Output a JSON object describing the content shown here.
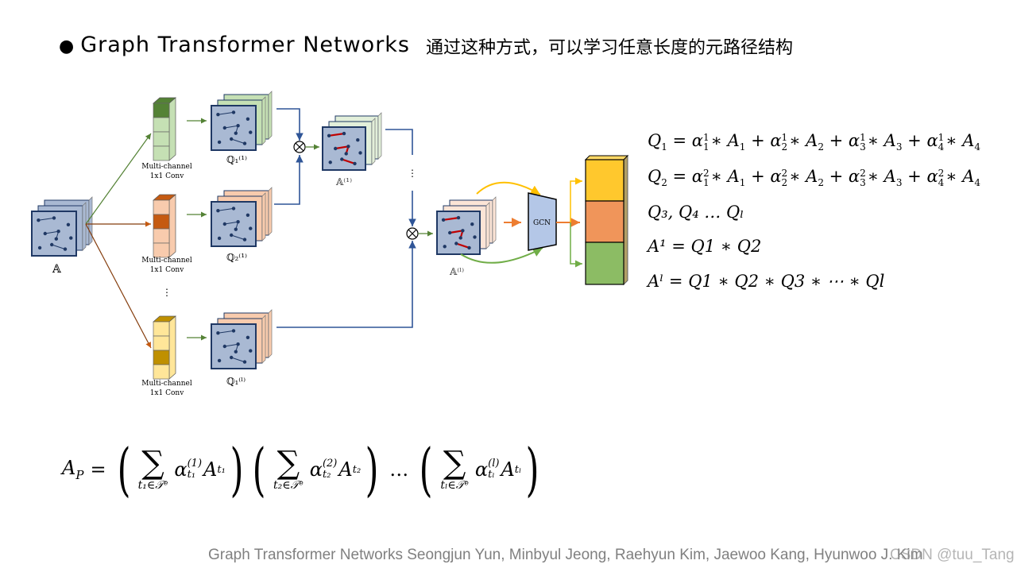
{
  "slide": {
    "bullet": "●",
    "title": "Graph Transformer Networks",
    "subtitle": "通过这种方式，可以学习任意长度的元路径结构"
  },
  "diagram": {
    "input_label": "𝔸",
    "conv_label_line1": "Multi-channel",
    "conv_label_line2": "1x1 Conv",
    "q_labels": [
      "ℚ₁⁽¹⁾",
      "ℚ₂⁽¹⁾",
      "ℚ₁⁽ˡ⁾"
    ],
    "a1_label": "𝔸⁽¹⁾",
    "al_label": "𝔸⁽ˡ⁾",
    "gcn_label": "GCN",
    "vdots": "⋮",
    "multiply_symbol": "⊗",
    "colors": {
      "graph_face": "#a9b9d3",
      "graph_border": "#1f3864",
      "edge_red": "#c00000",
      "green_dark": "#548235",
      "green_light": "#c5e0b4",
      "orange_dark": "#c55a11",
      "orange_light": "#f8cbad",
      "yellow_dark": "#bf9000",
      "yellow_light": "#ffe699",
      "output_yellow": "#ffc82d",
      "output_orange": "#f0955a",
      "output_green": "#8cbc64",
      "gcn_fill": "#b4c7e7",
      "line_blue": "#2f5597"
    }
  },
  "equations": {
    "q1": {
      "lhs": "Q",
      "lhs_sub": "1",
      "terms": [
        {
          "sup": "1",
          "sub": "1",
          "a_sub": "1"
        },
        {
          "sup": "1",
          "sub": "2",
          "a_sub": "2"
        },
        {
          "sup": "1",
          "sub": "3",
          "a_sub": "3"
        },
        {
          "sup": "1",
          "sub": "4",
          "a_sub": "4"
        }
      ]
    },
    "q2": {
      "lhs": "Q",
      "lhs_sub": "2",
      "terms": [
        {
          "sup": "2",
          "sub": "1",
          "a_sub": "1"
        },
        {
          "sup": "2",
          "sub": "2",
          "a_sub": "2"
        },
        {
          "sup": "2",
          "sub": "3",
          "a_sub": "3"
        },
        {
          "sup": "2",
          "sub": "4",
          "a_sub": "4"
        }
      ]
    },
    "q_rest": "Q₃, Q₄ … Qₗ",
    "a1": "A¹ = Q1 ∗ Q2",
    "al": "Aˡ = Q1 ∗ Q2 ∗ Q3 ∗ ⋯ ∗ Ql"
  },
  "formula": {
    "lhs": "A",
    "lhs_sub": "P",
    "eq": "=",
    "blocks": [
      {
        "under": "t₁∈𝒯ᵉ",
        "alpha_sup": "(1)",
        "alpha_sub": "t₁",
        "a_sub": "t₁"
      },
      {
        "under": "t₂∈𝒯ᵉ",
        "alpha_sup": "(2)",
        "alpha_sub": "t₂",
        "a_sub": "t₂"
      },
      {
        "under": "tₗ∈𝒯ᵉ",
        "alpha_sup": "(l)",
        "alpha_sub": "tₗ",
        "a_sub": "tₗ"
      }
    ],
    "ellipsis": "…",
    "sigma": "∑",
    "alpha": "α",
    "a": "A"
  },
  "footer": {
    "citation": "Graph Transformer Networks Seongjun Yun, Minbyul Jeong, Raehyun Kim, Jaewoo Kang, Hyunwoo J. Kim",
    "watermark": "CSDN @tuu_Tang"
  }
}
